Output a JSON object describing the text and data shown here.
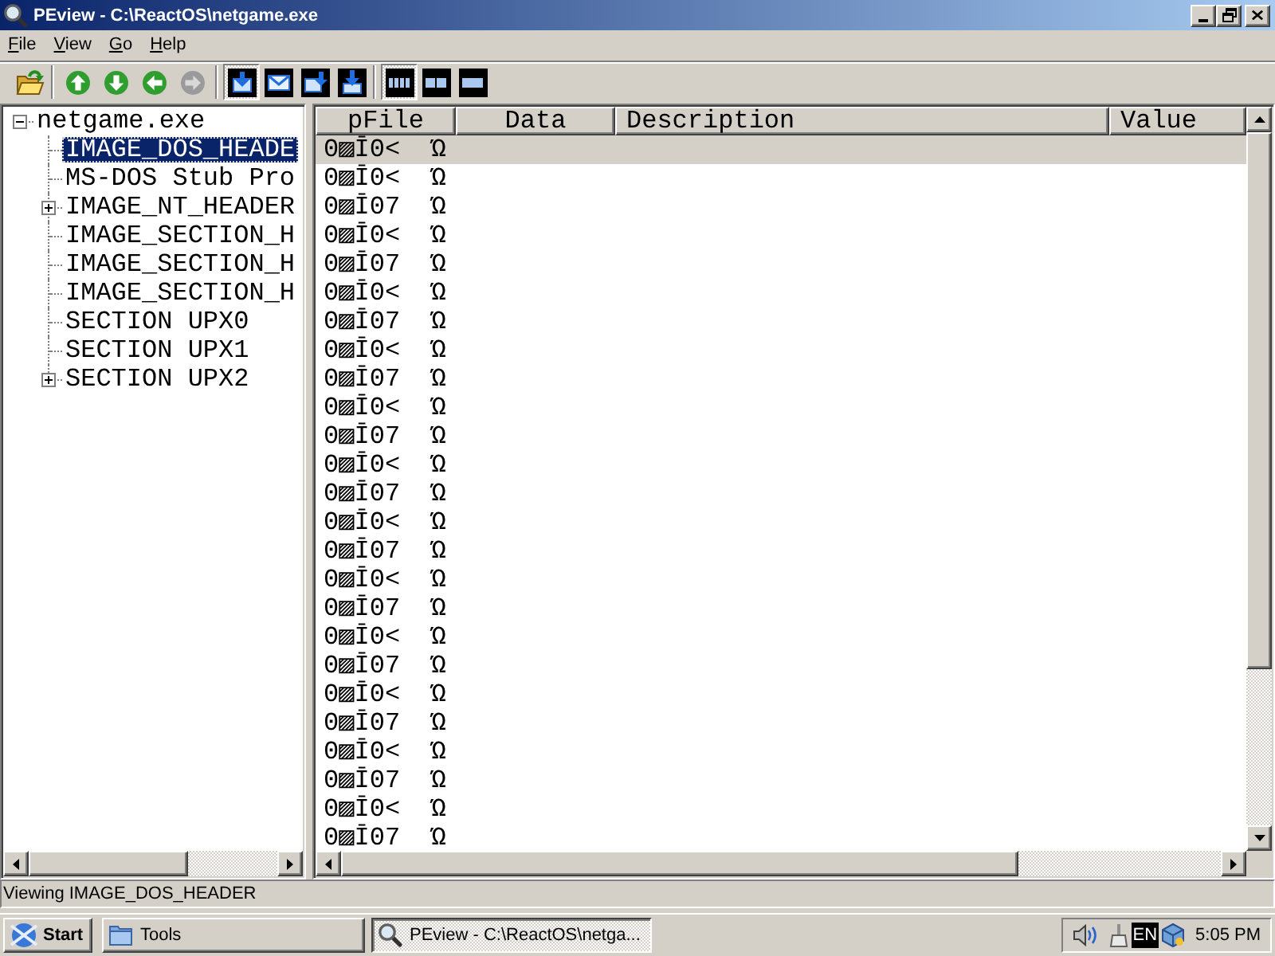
{
  "window": {
    "title": "PEview - C:\\ReactOS\\netgame.exe",
    "maximized": true
  },
  "menu": [
    "File",
    "View",
    "Go",
    "Help"
  ],
  "toolbar": [
    {
      "buttons": [
        {
          "kind": "open",
          "disabled": false
        }
      ]
    },
    {
      "buttons": [
        {
          "kind": "up",
          "disabled": false
        },
        {
          "kind": "down",
          "disabled": false
        },
        {
          "kind": "back",
          "disabled": false
        },
        {
          "kind": "forward",
          "disabled": true
        }
      ]
    },
    {
      "buttons": [
        {
          "kind": "tray",
          "selected": true
        },
        {
          "kind": "envelope",
          "selected": false
        },
        {
          "kind": "sidedrop",
          "selected": false
        },
        {
          "kind": "topdrop",
          "selected": false
        }
      ]
    },
    {
      "buttons": [
        {
          "kind": "quad",
          "selected": true
        },
        {
          "kind": "dual",
          "selected": false
        },
        {
          "kind": "single",
          "selected": false
        }
      ]
    }
  ],
  "tree": [
    {
      "label": "netgame.exe",
      "expanded": true,
      "selected": false,
      "children": [
        {
          "label": "IMAGE_DOS_HEADE",
          "selected": true
        },
        {
          "label": "MS-DOS Stub Pro",
          "selected": false
        },
        {
          "label": "IMAGE_NT_HEADER",
          "expanded": false,
          "selected": false
        },
        {
          "label": "IMAGE_SECTION_H",
          "selected": false
        },
        {
          "label": "IMAGE_SECTION_H",
          "selected": false
        },
        {
          "label": "IMAGE_SECTION_H",
          "selected": false
        },
        {
          "label": "SECTION UPX0",
          "selected": false
        },
        {
          "label": "SECTION UPX1",
          "selected": false
        },
        {
          "label": "SECTION UPX2",
          "expanded": false,
          "selected": false
        }
      ]
    }
  ],
  "table": {
    "columns": [
      "pFile",
      "Data",
      "Description",
      "Value"
    ],
    "rows": [
      {
        "pfile": "0▨Ī0<  Ώ",
        "selected": true
      },
      {
        "pfile": "0▨Ī0<  Ώ",
        "selected": false
      },
      {
        "pfile": "0▨Ī07  Ώ",
        "selected": false
      },
      {
        "pfile": "0▨Ī0<  Ώ",
        "selected": false
      },
      {
        "pfile": "0▨Ī07  Ώ",
        "selected": false
      },
      {
        "pfile": "0▨Ī0<  Ώ",
        "selected": false
      },
      {
        "pfile": "0▨Ī07  Ώ",
        "selected": false
      },
      {
        "pfile": "0▨Ī0<  Ώ",
        "selected": false
      },
      {
        "pfile": "0▨Ī07  Ώ",
        "selected": false
      },
      {
        "pfile": "0▨Ī0<  Ώ",
        "selected": false
      },
      {
        "pfile": "0▨Ī07  Ώ",
        "selected": false
      },
      {
        "pfile": "0▨Ī0<  Ώ",
        "selected": false
      },
      {
        "pfile": "0▨Ī07  Ώ",
        "selected": false
      },
      {
        "pfile": "0▨Ī0<  Ώ",
        "selected": false
      },
      {
        "pfile": "0▨Ī07  Ώ",
        "selected": false
      },
      {
        "pfile": "0▨Ī0<  Ώ",
        "selected": false
      },
      {
        "pfile": "0▨Ī07  Ώ",
        "selected": false
      },
      {
        "pfile": "0▨Ī0<  Ώ",
        "selected": false
      },
      {
        "pfile": "0▨Ī07  Ώ",
        "selected": false
      },
      {
        "pfile": "0▨Ī0<  Ώ",
        "selected": false
      },
      {
        "pfile": "0▨Ī07  Ώ",
        "selected": false
      },
      {
        "pfile": "0▨Ī0<  Ώ",
        "selected": false
      },
      {
        "pfile": "0▨Ī07  Ώ",
        "selected": false
      },
      {
        "pfile": "0▨Ī0<  Ώ",
        "selected": false
      },
      {
        "pfile": "0▨Ī07  Ώ",
        "selected": false
      }
    ]
  },
  "status_bar": {
    "text": "Viewing IMAGE_DOS_HEADER"
  },
  "taskbar": {
    "start": "Start",
    "buttons": [
      {
        "label": "Tools",
        "kind": "folder",
        "selected": false
      },
      {
        "label": "PEview - C:\\ReactOS\\netga...",
        "kind": "viewer",
        "selected": true
      }
    ],
    "tray": {
      "language": "EN",
      "clock": "5:05 PM"
    }
  }
}
